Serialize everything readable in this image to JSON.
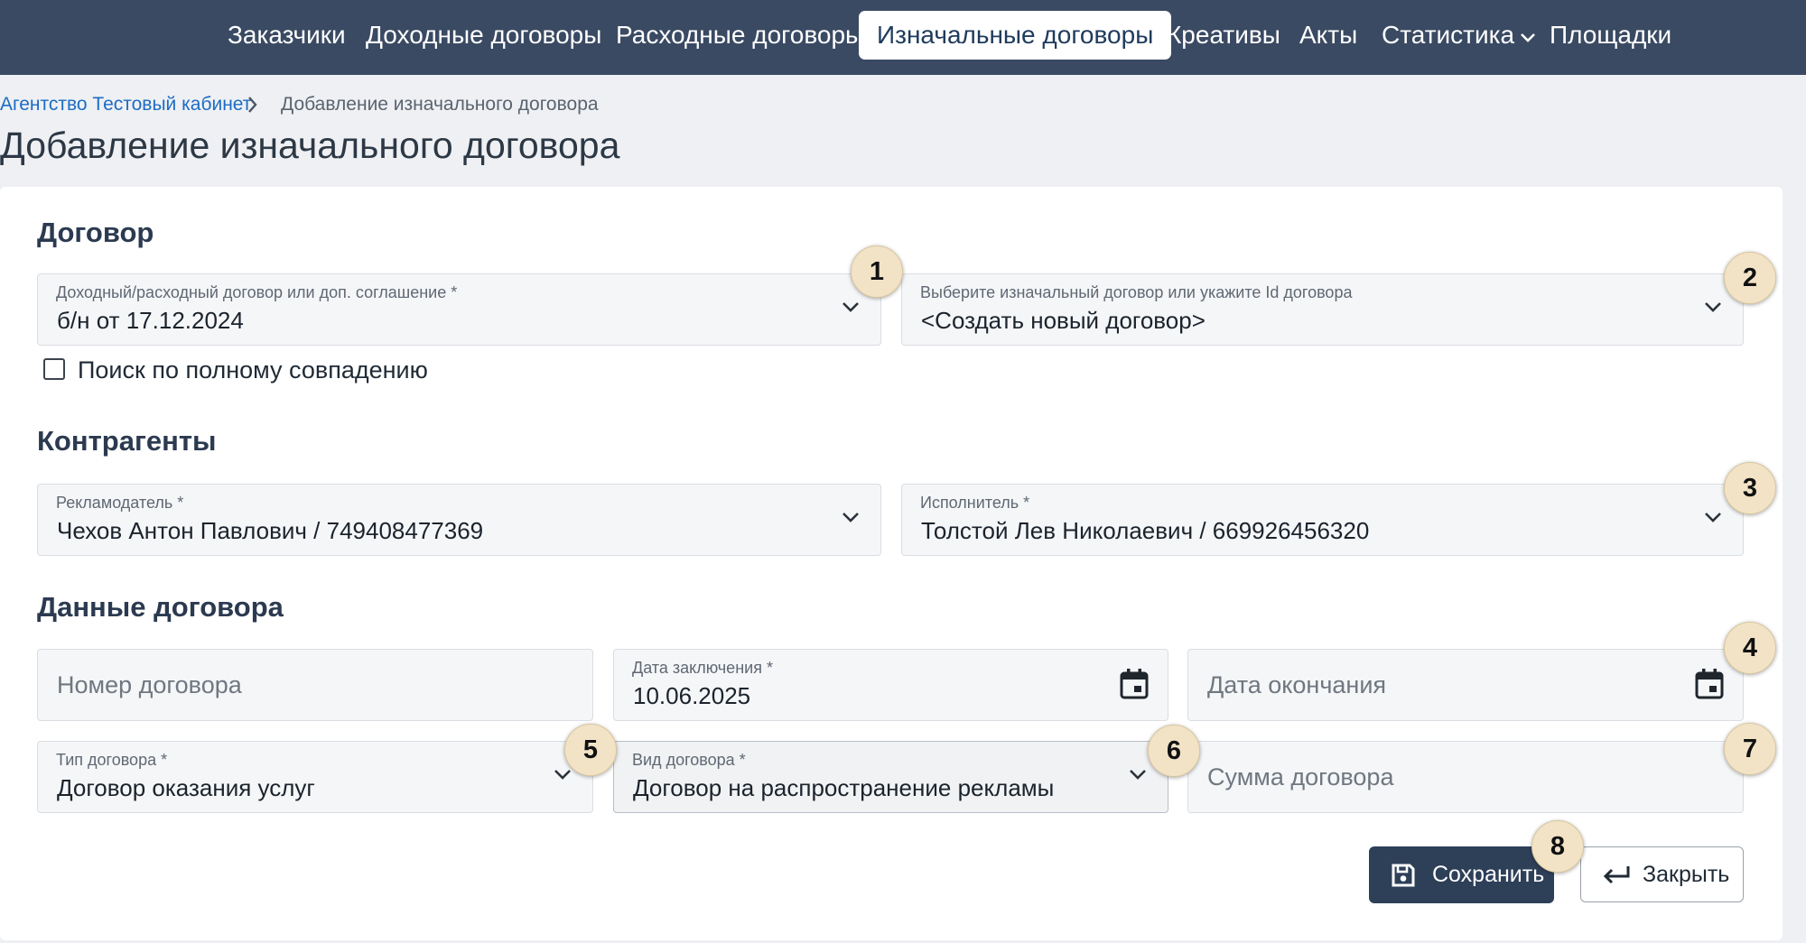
{
  "nav": {
    "items": [
      {
        "label": "Заказчики"
      },
      {
        "label": "Доходные договоры"
      },
      {
        "label": "Расходные договоры"
      },
      {
        "label": "Изначальные договоры",
        "active": true
      },
      {
        "label": "Креативы"
      },
      {
        "label": "Акты"
      },
      {
        "label": "Статистика",
        "has_dropdown": true
      },
      {
        "label": "Площадки"
      }
    ]
  },
  "breadcrumb": {
    "parent": "Агентство Тестовый кабинет",
    "separator_icon": "chevron-right-icon",
    "current": "Добавление изначального договора"
  },
  "page_title": "Добавление изначального договора",
  "sections": {
    "contract": {
      "title": "Договор",
      "parent_contract": {
        "label": "Доходный/расходный договор или доп. соглашение *",
        "value": "б/н от 17.12.2024"
      },
      "initial_contract": {
        "label": "Выберите изначальный договор или укажите Id договора",
        "value": "<Создать новый договор>"
      },
      "exact_match": {
        "label": "Поиск по полному совпадению",
        "checked": false
      }
    },
    "counterparties": {
      "title": "Контрагенты",
      "advertiser": {
        "label": "Рекламодатель *",
        "value": "Чехов Антон Павлович / 749408477369"
      },
      "executor": {
        "label": "Исполнитель *",
        "value": "Толстой Лев Николаевич / 669926456320"
      }
    },
    "contract_data": {
      "title": "Данные договора",
      "number": {
        "placeholder": "Номер договора"
      },
      "date_signed": {
        "label": "Дата заключения *",
        "value": "10.06.2025"
      },
      "date_end": {
        "placeholder": "Дата окончания"
      },
      "contract_type": {
        "label": "Тип договора *",
        "value": "Договор оказания услуг"
      },
      "contract_kind": {
        "label": "Вид договора *",
        "value": "Договор на распространение рекламы"
      },
      "amount": {
        "placeholder": "Сумма договора"
      }
    }
  },
  "actions": {
    "save_label": "Сохранить",
    "save_icon": "floppy-disk-icon",
    "close_label": "Закрыть",
    "close_icon": "return-arrow-icon"
  },
  "markers": [
    "1",
    "2",
    "3",
    "4",
    "5",
    "6",
    "7",
    "8"
  ],
  "colors": {
    "nav_background": "#3a4a63",
    "link": "#1d6cc4",
    "primary_button": "#2e3f58",
    "marker_background": "#f2e3c6"
  }
}
